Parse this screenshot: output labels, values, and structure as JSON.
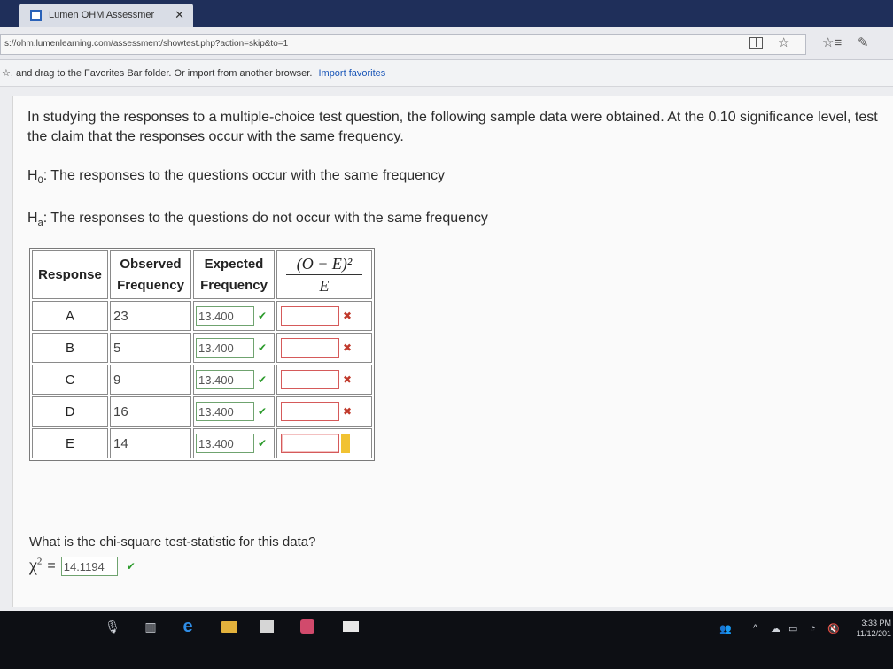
{
  "browser": {
    "tab_title": "Lumen OHM Assessmer",
    "tab_close": "✕",
    "url": "s://ohm.lumenlearning.com/assessment/showtest.php?action=skip&to=1",
    "favorites_bar_text": "☆, and drag to the Favorites Bar folder. Or import from another browser.",
    "import_link": "Import favorites"
  },
  "question": {
    "prompt": "In studying the responses to a multiple-choice test question, the following sample data were obtained. At the 0.10 significance level, test the claim that the responses occur with the same frequency.",
    "h0_label": "H",
    "h0_sub": "0",
    "h0_text": ": The responses to the questions occur with the same frequency",
    "ha_label": "H",
    "ha_sub": "a",
    "ha_text": ": The responses to the questions do not occur with the same frequency"
  },
  "table": {
    "headers": {
      "response": "Response",
      "observed_1": "Observed",
      "observed_2": "Frequency",
      "expected_1": "Expected",
      "expected_2": "Frequency",
      "formula_num": "(O − E)²",
      "formula_den": "E"
    },
    "rows": [
      {
        "response": "A",
        "observed": "23",
        "expected": "13.400"
      },
      {
        "response": "B",
        "observed": "5",
        "expected": "13.400"
      },
      {
        "response": "C",
        "observed": "9",
        "expected": "13.400"
      },
      {
        "response": "D",
        "observed": "16",
        "expected": "13.400"
      },
      {
        "response": "E",
        "observed": "14",
        "expected": "13.400"
      }
    ],
    "check_mark": "✔",
    "cross_mark": "✖"
  },
  "chi_square": {
    "question": "What is the chi-square test-statistic for this data?",
    "symbol": "χ",
    "sup": "2",
    "equals": "=",
    "value": "14.1194"
  },
  "taskbar": {
    "time": "3:33 PM",
    "date": "11/12/201"
  }
}
